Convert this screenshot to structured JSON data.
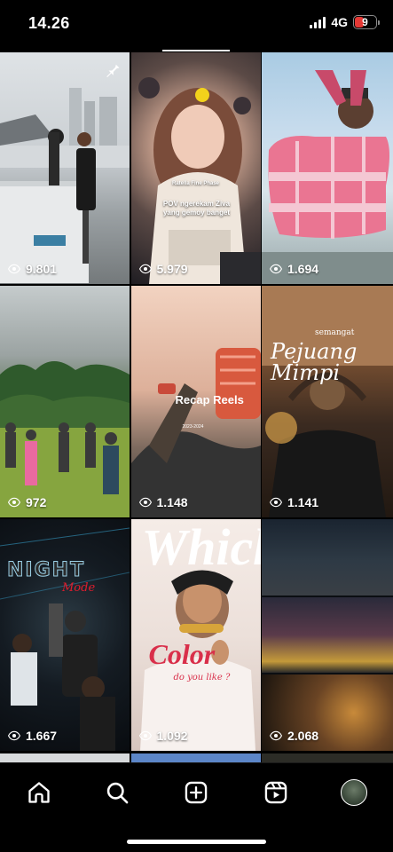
{
  "status_bar": {
    "time": "14.26",
    "network": "4G",
    "battery": "9",
    "battery_color": "#e53935"
  },
  "posts": [
    {
      "views": "9.801",
      "pinned": true,
      "exit_sign": "←[□"
    },
    {
      "views": "5.979",
      "caption_top": "Ratella Fine Phase",
      "caption": "POV ngerekam Ziva yang gemoy banget"
    },
    {
      "views": "1.694"
    },
    {
      "views": "972"
    },
    {
      "views": "1.148",
      "overlay_title": "Recap Reels",
      "overlay_sub": "2023-2024"
    },
    {
      "views": "1.141",
      "overlay_small": "semangat",
      "overlay_title": "Pejuang Mimpi"
    },
    {
      "views": "1.667",
      "overlay_title": "NIGHT",
      "overlay_script": "Mode"
    },
    {
      "views": "1.092",
      "overlay_title": "Which",
      "overlay_mid": "Color",
      "overlay_sub": "do you like ?"
    },
    {
      "views": "2.068"
    }
  ],
  "nav": {
    "items": [
      "home",
      "search",
      "create",
      "reels",
      "profile"
    ]
  },
  "icons": {
    "eye": "eye-icon",
    "pin": "pin-icon",
    "home": "home-icon",
    "search": "search-icon",
    "create": "plus-square-icon",
    "reels": "reels-icon"
  }
}
